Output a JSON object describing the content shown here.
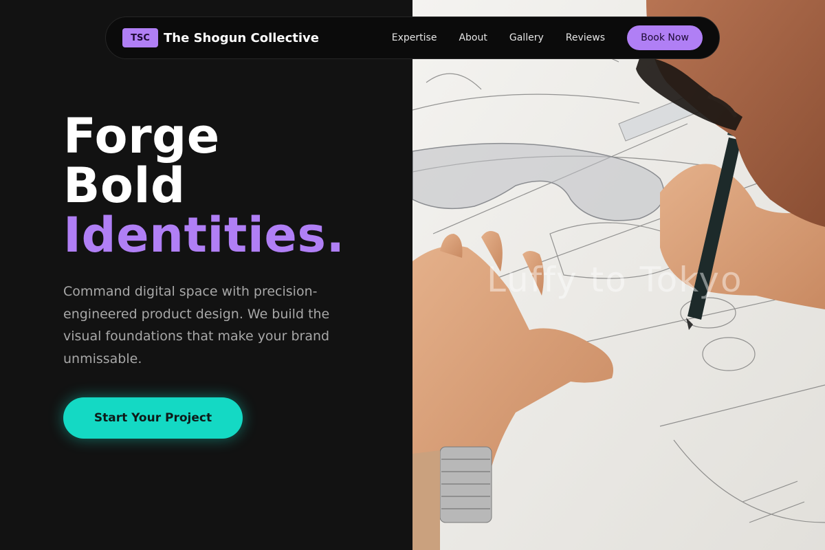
{
  "nav": {
    "logo_badge": "TSC",
    "brand": "The Shogun Collective",
    "links": [
      "Expertise",
      "About",
      "Gallery",
      "Reviews"
    ],
    "cta": "Book Now"
  },
  "hero": {
    "headline_line1": "Forge",
    "headline_line2": "Bold",
    "headline_line3": "Identities.",
    "subtitle": "Command digital space with precision-engineered product design. We build the visual foundations that make your brand unmissable.",
    "cta": "Start Your Project"
  },
  "image": {
    "watermark": "Luffy to Tokyo"
  },
  "colors": {
    "accent_purple": "#b07ff5",
    "accent_teal": "#14d9c4",
    "background": "#121212"
  }
}
